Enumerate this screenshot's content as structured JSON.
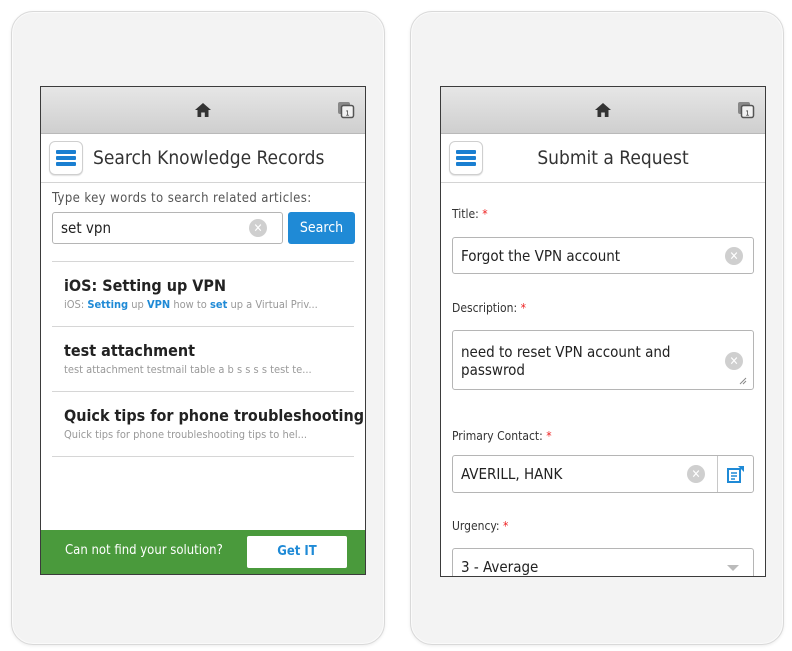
{
  "search_screen": {
    "header_title": "Search Knowledge Records",
    "hint": "Type key words to search related articles:",
    "search_value": "set vpn",
    "search_button": "Search",
    "results": [
      {
        "title": "iOS: Setting up VPN",
        "snippet_parts": [
          {
            "text": "iOS: ",
            "hl": false
          },
          {
            "text": "Setting",
            "hl": true
          },
          {
            "text": " up ",
            "hl": false
          },
          {
            "text": "VPN",
            "hl": true
          },
          {
            "text": " how to ",
            "hl": false
          },
          {
            "text": "set",
            "hl": true
          },
          {
            "text": " up a Virtual Priv...",
            "hl": false
          }
        ]
      },
      {
        "title": "test attachment",
        "snippet_parts": [
          {
            "text": "test attachment testmail table a b s s s s test te...",
            "hl": false
          }
        ]
      },
      {
        "title": "Quick tips for phone troubleshooting",
        "snippet_parts": [
          {
            "text": "Quick tips for phone troubleshooting tips to hel...",
            "hl": false
          }
        ]
      }
    ],
    "footer_text": "Can not find your solution?",
    "footer_button": "Get IT"
  },
  "request_screen": {
    "header_title": "Submit a Request",
    "fields": {
      "title": {
        "label": "Title:",
        "required": "*",
        "value": "Forgot the VPN account"
      },
      "description": {
        "label": "Description:",
        "required": "*",
        "value": "need to reset VPN account and passwrod"
      },
      "primary_contact": {
        "label": "Primary Contact:",
        "required": "*",
        "value": "AVERILL, HANK"
      },
      "urgency": {
        "label": "Urgency:",
        "required": "*",
        "value": "3 - Average"
      }
    }
  },
  "colors": {
    "accent": "#1f8ad6",
    "footer": "#4a9a3c",
    "required": "#e22222"
  },
  "icons": [
    "home-icon",
    "tabs-icon",
    "menu-icon",
    "clear-icon",
    "contact-lookup-icon",
    "chevron-down-icon"
  ]
}
